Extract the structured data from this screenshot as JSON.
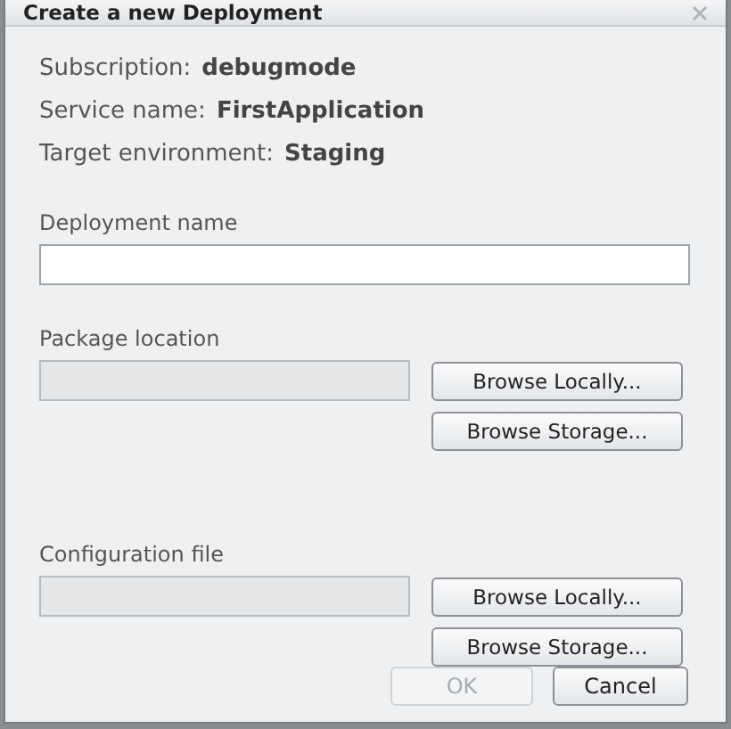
{
  "window": {
    "title": "Create a new Deployment"
  },
  "info": [
    {
      "label": "Subscription:",
      "value": "debugmode"
    },
    {
      "label": "Service name:",
      "value": "FirstApplication"
    },
    {
      "label": "Target environment:",
      "value": "Staging"
    }
  ],
  "deployment_name": {
    "label": "Deployment name",
    "disabled": false
  },
  "sections": [
    {
      "label": "Package location",
      "field_disabled": true,
      "buttons": [
        "Browse Locally...",
        "Browse Storage..."
      ]
    },
    {
      "label": "Configuration file",
      "field_disabled": true,
      "buttons": [
        "Browse Locally...",
        "Browse Storage..."
      ]
    }
  ],
  "footer_buttons": [
    {
      "label": "OK",
      "disabled": true
    },
    {
      "label": "Cancel",
      "disabled": false
    }
  ]
}
